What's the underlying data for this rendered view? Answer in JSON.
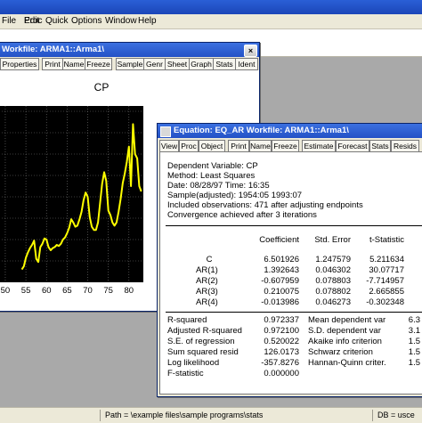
{
  "menu": [
    "File",
    "Edit",
    "Proc",
    "Quick",
    "Options",
    "Window",
    "Help"
  ],
  "status": {
    "path": "Path = \\example files\\sample programs\\stats",
    "db": "DB = usce"
  },
  "workfile_window": {
    "title": "Workfile: ARMA1::Arma1\\",
    "toolbar": [
      "Properties",
      "Print",
      "Name",
      "Freeze",
      "Sample",
      "Genr",
      "Sheet",
      "Graph",
      "Stats",
      "Ident"
    ]
  },
  "chart_data": {
    "type": "line",
    "title": "CP",
    "x_tick_labels": [
      "50",
      "55",
      "60",
      "65",
      "70",
      "75",
      "80"
    ],
    "x_ticks": [
      1950,
      1955,
      1960,
      1965,
      1970,
      1975,
      1980
    ],
    "xlim": [
      1948.5,
      1983.5
    ],
    "ylim": [
      0,
      16.5
    ],
    "color": "#ffff00",
    "grid": true,
    "series": [
      {
        "x": [
          1954,
          1954.5,
          1955,
          1955.5,
          1956,
          1956.5,
          1957,
          1957.5,
          1958,
          1958.5,
          1959,
          1959.5,
          1960,
          1960.5,
          1961,
          1961.5,
          1962,
          1962.5,
          1963,
          1963.5,
          1964,
          1964.5,
          1965,
          1965.5,
          1966,
          1966.5,
          1967,
          1967.5,
          1968,
          1968.5,
          1969,
          1969.5,
          1970,
          1970.5,
          1971,
          1971.5,
          1972,
          1972.5,
          1973,
          1973.5,
          1974,
          1974.5,
          1975,
          1975.5,
          1976,
          1976.5,
          1977,
          1977.5,
          1978,
          1978.5,
          1979,
          1979.5,
          1980,
          1980.5,
          1981,
          1981.5,
          1982,
          1982.5,
          1983
        ],
        "y": [
          1.2,
          1.5,
          2.3,
          2.8,
          3.2,
          3.5,
          3.9,
          2.2,
          1.9,
          3.3,
          3.6,
          4.1,
          4.0,
          3.3,
          3.0,
          3.2,
          3.3,
          3.5,
          3.4,
          3.6,
          4.0,
          4.2,
          4.6,
          5.1,
          5.9,
          5.6,
          5.2,
          5.3,
          5.9,
          6.6,
          7.7,
          8.4,
          8.0,
          6.1,
          5.2,
          4.9,
          4.9,
          5.6,
          7.4,
          9.2,
          10.3,
          9.5,
          6.7,
          6.3,
          5.6,
          5.3,
          5.6,
          6.6,
          7.8,
          9.3,
          10.2,
          11.3,
          12.7,
          9.0,
          14.8,
          12.0,
          11.6,
          9.0,
          8.5
        ]
      }
    ]
  },
  "equation_window": {
    "title": "Equation: EQ_AR   Workfile: ARMA1::Arma1\\",
    "toolbar": [
      "View",
      "Proc",
      "Object",
      "Print",
      "Name",
      "Freeze",
      "Estimate",
      "Forecast",
      "Stats",
      "Resids"
    ],
    "header_lines": [
      "Dependent Variable: CP",
      "Method: Least Squares",
      "Date: 08/28/97   Time: 16:35",
      "Sample(adjusted): 1954:05 1993:07",
      "Included observations: 471 after adjusting endpoints",
      "Convergence achieved after 3 iterations"
    ],
    "columns": [
      "Coefficient",
      "Std. Error",
      "t-Statistic"
    ],
    "rows": [
      {
        "var": "C",
        "coef": "6.501926",
        "se": "1.247579",
        "t": "5.211634"
      },
      {
        "var": "AR(1)",
        "coef": "1.392643",
        "se": "0.046302",
        "t": "30.07717"
      },
      {
        "var": "AR(2)",
        "coef": "-0.607959",
        "se": "0.078803",
        "t": "-7.714957"
      },
      {
        "var": "AR(3)",
        "coef": "0.210075",
        "se": "0.078802",
        "t": "2.665855"
      },
      {
        "var": "AR(4)",
        "coef": "-0.013986",
        "se": "0.046273",
        "t": "-0.302348"
      }
    ],
    "stats_left": [
      {
        "label": "R-squared",
        "value": "0.972337"
      },
      {
        "label": "Adjusted R-squared",
        "value": "0.972100"
      },
      {
        "label": "S.E. of regression",
        "value": "0.520022"
      },
      {
        "label": "Sum squared resid",
        "value": "126.0173"
      },
      {
        "label": "Log likelihood",
        "value": "-357.8276"
      },
      {
        "label": "F-statistic",
        "value": "0.000000"
      }
    ],
    "stats_right": [
      {
        "label": "Mean dependent var",
        "value": "6.3"
      },
      {
        "label": "S.D. dependent var",
        "value": "3.1"
      },
      {
        "label": "Akaike info criterion",
        "value": "1.5"
      },
      {
        "label": "Schwarz criterion",
        "value": "1.5"
      },
      {
        "label": "Hannan-Quinn criter.",
        "value": "1.5"
      }
    ]
  }
}
